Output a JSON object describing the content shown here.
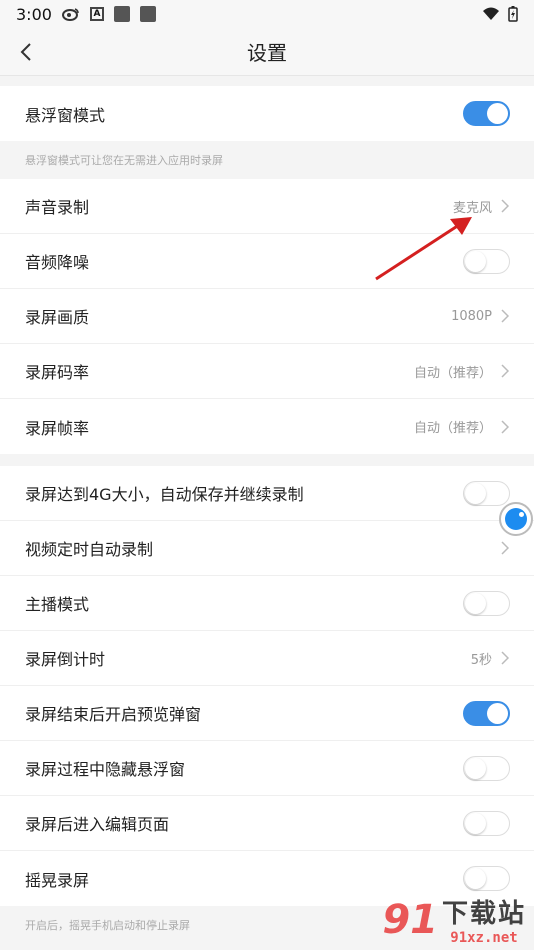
{
  "status_bar": {
    "time": "3:00",
    "a_icon": "A"
  },
  "header": {
    "title": "设置"
  },
  "group1": {
    "rows": [
      {
        "label": "悬浮窗模式",
        "toggle_on": true
      }
    ],
    "note": "悬浮窗模式可让您在无需进入应用时录屏"
  },
  "group2": {
    "rows": [
      {
        "label": "声音录制",
        "value": "麦克风"
      },
      {
        "label": "音频降噪",
        "toggle_on": false
      },
      {
        "label": "录屏画质",
        "value": "1080P"
      },
      {
        "label": "录屏码率",
        "value": "自动（推荐）"
      },
      {
        "label": "录屏帧率",
        "value": "自动（推荐）"
      }
    ]
  },
  "group3": {
    "rows": [
      {
        "label": "录屏达到4G大小，自动保存并继续录制",
        "toggle_on": false
      },
      {
        "label": "视频定时自动录制"
      },
      {
        "label": "主播模式",
        "toggle_on": false
      },
      {
        "label": "录屏倒计时",
        "value": "5秒"
      },
      {
        "label": "录屏结束后开启预览弹窗",
        "toggle_on": true
      },
      {
        "label": "录屏过程中隐藏悬浮窗",
        "toggle_on": false
      },
      {
        "label": "录屏后进入编辑页面",
        "toggle_on": false
      },
      {
        "label": "摇晃录屏",
        "toggle_on": false
      }
    ],
    "note": "开启后，摇晃手机启动和停止录屏"
  },
  "watermark": {
    "cn": "下载站",
    "url": "91xz.net"
  },
  "colors": {
    "accent": "#3a8ee6",
    "arrow": "#d42020",
    "watermark_red": "#e83c3c"
  }
}
